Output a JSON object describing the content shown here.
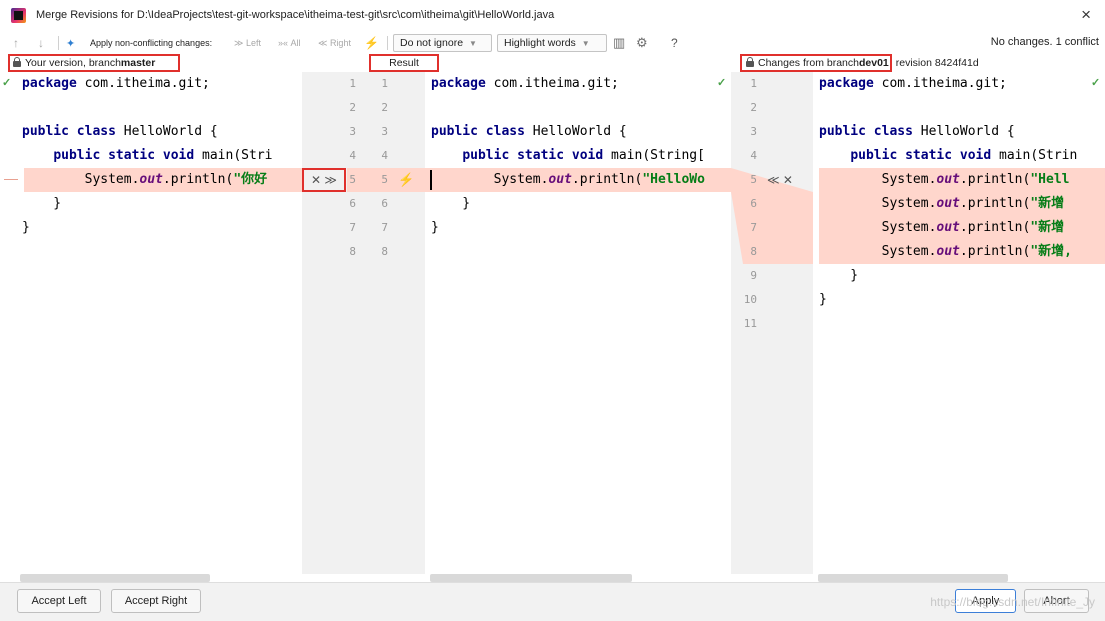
{
  "window": {
    "title": "Merge Revisions for D:\\IdeaProjects\\test-git-workspace\\itheima-test-git\\src\\com\\itheima\\git\\HelloWorld.java",
    "close_glyph": "×"
  },
  "toolbar": {
    "apply_nonconflicting_label": "Apply non-conflicting changes:",
    "left_label": "Left",
    "all_label": "All",
    "right_label": "Right",
    "whitespace_select": "Do not ignore",
    "highlight_select": "Highlight words",
    "help_glyph": "?",
    "status": "No changes. 1 conflict"
  },
  "panels": {
    "left_header_prefix": "Your version, branch ",
    "left_header_branch": "master",
    "center_header": "Result",
    "right_header_prefix": "Changes from branch ",
    "right_header_branch": "dev01",
    "right_header_revision": "revision 8424f41d"
  },
  "left_code": [
    "package com.itheima.git;",
    "",
    "public class HelloWorld {",
    "    public static void main(Stri",
    "        System.out.println(\"你好",
    "    }",
    "}"
  ],
  "center_code": [
    "package com.itheima.git;",
    "",
    "public class HelloWorld {",
    "    public static void main(String[",
    "        System.out.println(\"HelloWo",
    "    }",
    "}"
  ],
  "right_code": [
    "package com.itheima.git;",
    "",
    "public class HelloWorld {",
    "    public static void main(Strin",
    "        System.out.println(\"Hell",
    "        System.out.println(\"新增",
    "        System.out.println(\"新增",
    "        System.out.println(\"新增,",
    "    }",
    "}"
  ],
  "left_line_numbers": [
    "1",
    "2",
    "3",
    "4",
    "5",
    "6",
    "7",
    "8"
  ],
  "center_line_numbers": [
    "1",
    "2",
    "3",
    "4",
    "5",
    "6",
    "7",
    "8"
  ],
  "right_line_numbers": [
    "1",
    "2",
    "3",
    "4",
    "5",
    "6",
    "7",
    "8",
    "9",
    "10",
    "11"
  ],
  "actions": {
    "left_conflict_glyphs": "✕ ≫",
    "right_conflict_glyphs": "≪ ✕"
  },
  "buttons": {
    "accept_left": "Accept Left",
    "accept_right": "Accept Right",
    "apply": "Apply",
    "abort": "Abort"
  },
  "watermark": "https://blog.csdn.net/Infinite_Jy",
  "colors": {
    "conflict_bg": "#ffd6cc",
    "annotation_red": "#e0302c",
    "keyword": "#000080",
    "string": "#067d17"
  }
}
